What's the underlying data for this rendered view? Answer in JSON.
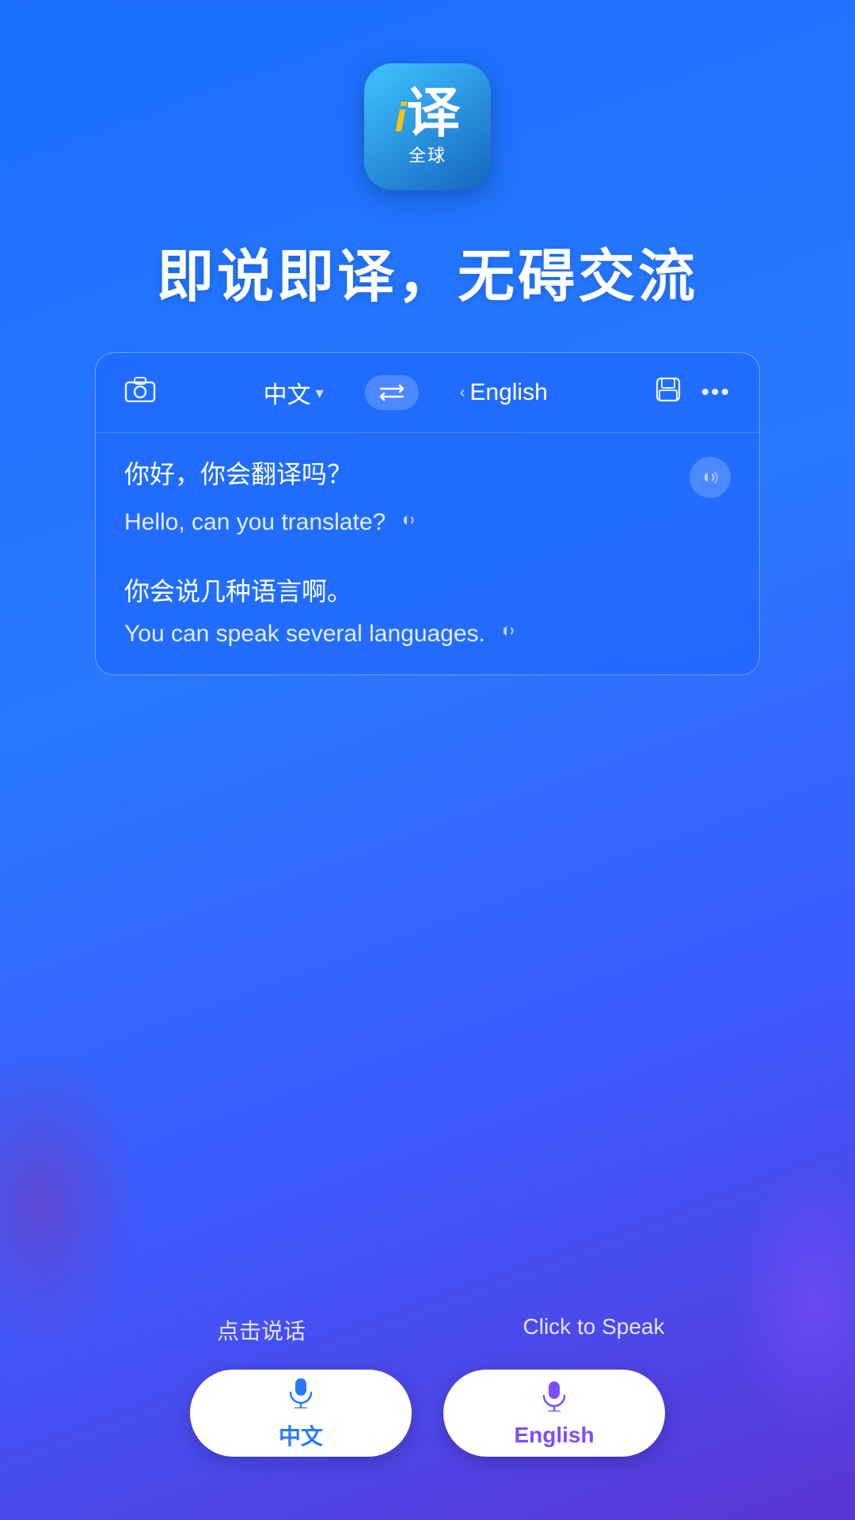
{
  "app": {
    "icon_char": "译",
    "icon_prefix": "i",
    "icon_subtitle": "全球"
  },
  "headline": "即说即译，无碍交流",
  "toolbar": {
    "source_lang": "中文",
    "target_lang": "English",
    "camera_icon": "📷",
    "swap_icon": "⇄",
    "save_icon": "💾",
    "more_icon": "···"
  },
  "translations": [
    {
      "source": "你好，你会翻译吗？",
      "result": "Hello, can you translate?"
    },
    {
      "source": "你会说几种语言啊。",
      "result": "You can speak several languages."
    }
  ],
  "bottom": {
    "label_zh": "点击说话",
    "label_en": "Click to Speak",
    "btn_zh_label": "中文",
    "btn_en_label": "English"
  }
}
